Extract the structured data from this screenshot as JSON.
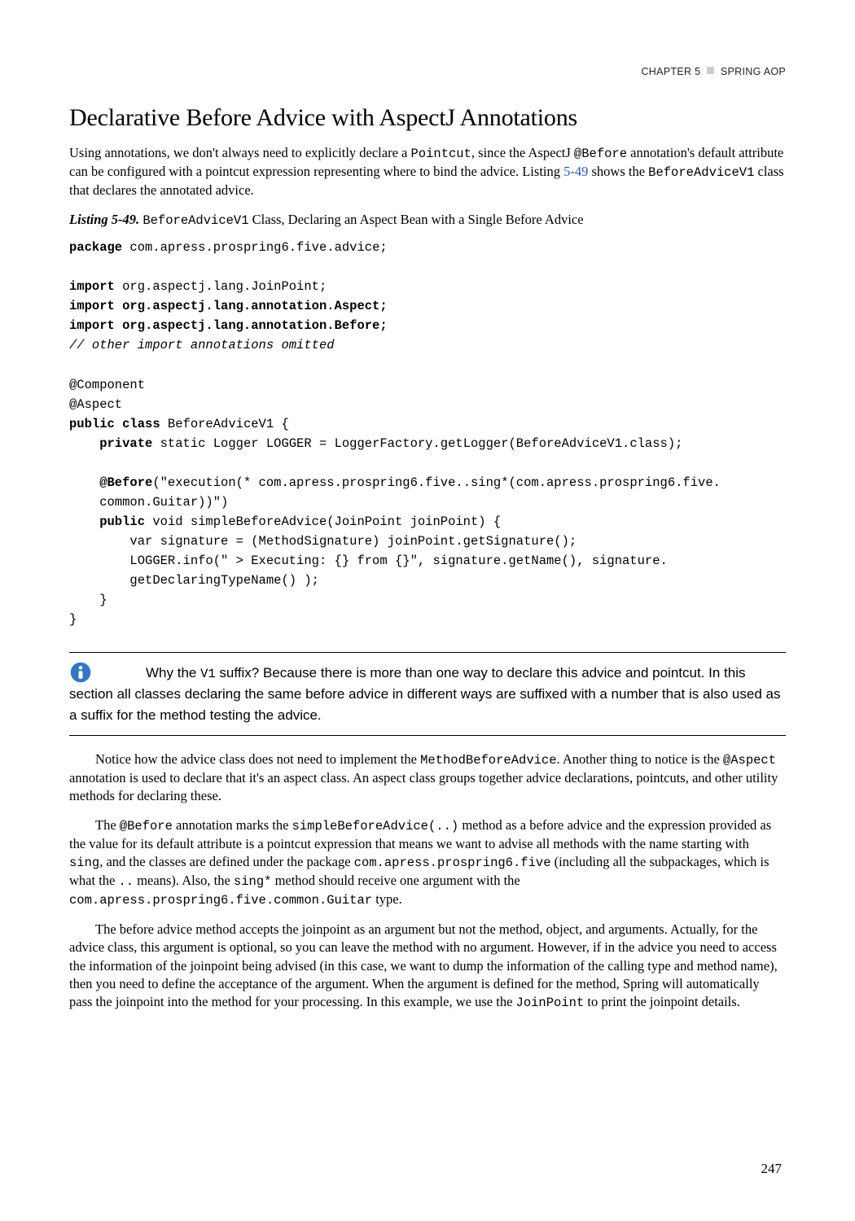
{
  "header": {
    "chapter": "CHAPTER 5",
    "title": "SPRING AOP"
  },
  "section": {
    "heading": "Declarative Before Advice with AspectJ Annotations"
  },
  "intro": {
    "p1a": "Using annotations, we don't always need to explicitly declare a ",
    "kw_pointcut": "Pointcut",
    "p1b": ", since the AspectJ ",
    "kw_before": "@Before",
    "p1c": " annotation's default attribute can be configured with a pointcut expression representing where to bind the advice. Listing ",
    "link_549": "5-49",
    "p1d": " shows the ",
    "kw_cls": "BeforeAdviceV1",
    "p1e": " class that declares the annotated advice."
  },
  "listing": {
    "label": "Listing 5-49.",
    "caption_a": "BeforeAdviceV1",
    "caption_b": " Class, Declaring an Aspect Bean with a Single Before Advice"
  },
  "code": {
    "l01a": "package",
    "l01b": " com.apress.prospring6.five.advice;",
    "l02": "",
    "l03a": "import",
    "l03b": " org.aspectj.lang.JoinPoint;",
    "l04": "import org.aspectj.lang.annotation.Aspect;",
    "l05": "import org.aspectj.lang.annotation.Before;",
    "l06": "// other import annotations omitted",
    "l07": "",
    "l08": "@Component",
    "l09": "@Aspect",
    "l10a": "public class",
    "l10b": " BeforeAdviceV1 {",
    "l11a": "    private",
    "l11b": " static Logger LOGGER = LoggerFactory.getLogger(BeforeAdviceV1.class);",
    "l12": "",
    "l13a": "    @Before",
    "l13b": "(\"execution(* com.apress.prospring6.five..sing*(com.apress.prospring6.five.",
    "l14": "    common.Guitar))\")",
    "l15a": "    public",
    "l15b": " void simpleBeforeAdvice(JoinPoint joinPoint) {",
    "l16": "        var signature = (MethodSignature) joinPoint.getSignature();",
    "l17": "        LOGGER.info(\" > Executing: {} from {}\", signature.getName(), signature.",
    "l18": "        getDeclaringTypeName() );",
    "l19": "    }",
    "l20": "}"
  },
  "note": {
    "t1": "Why the ",
    "kw_v1": "V1",
    "t2": " suffix? Because there is more than one way to declare this advice and pointcut. In this section all classes declaring the same before advice in different ways are suffixed with a number that is also used as a suffix for the method testing the advice."
  },
  "para2": {
    "a": "Notice how the advice class does not need to implement the ",
    "kw1": "MethodBeforeAdvice",
    "b": ". Another thing to notice is the ",
    "kw2": "@Aspect",
    "c": " annotation is used to declare that it's an aspect class. An aspect class groups together advice declarations, pointcuts, and other utility methods for declaring these."
  },
  "para3": {
    "a": "The ",
    "kw1": "@Before",
    "b": " annotation marks the ",
    "kw2": "simpleBeforeAdvice(..)",
    "c": " method as a before advice and the expression provided as the value for its default attribute is a pointcut expression that means we want to advise all methods with the name starting with ",
    "kw3": "sing",
    "d": ", and the classes are defined under the package ",
    "kw4": "com.apress.prospring6.five",
    "e": " (including all the subpackages, which is what the ",
    "kw5": "..",
    "f": " means). Also, the ",
    "kw6": "sing*",
    "g": " method should receive one argument with the ",
    "kw7": "com.apress.prospring6.five.common.Guitar",
    "h": " type."
  },
  "para4": {
    "a": "The before advice method accepts the joinpoint as an argument but not the method, object, and arguments. Actually, for the advice class, this argument is optional, so you can leave the method with no argument. However, if in the advice you need to access the information of the joinpoint being advised (in this case, we want to dump the information of the calling type and method name), then you need to define the acceptance of the argument. When the argument is defined for the method, Spring will automatically pass the joinpoint into the method for your processing. In this example, we use the ",
    "kw1": "JoinPoint",
    "b": " to print the joinpoint details."
  },
  "page": {
    "number": "247"
  }
}
